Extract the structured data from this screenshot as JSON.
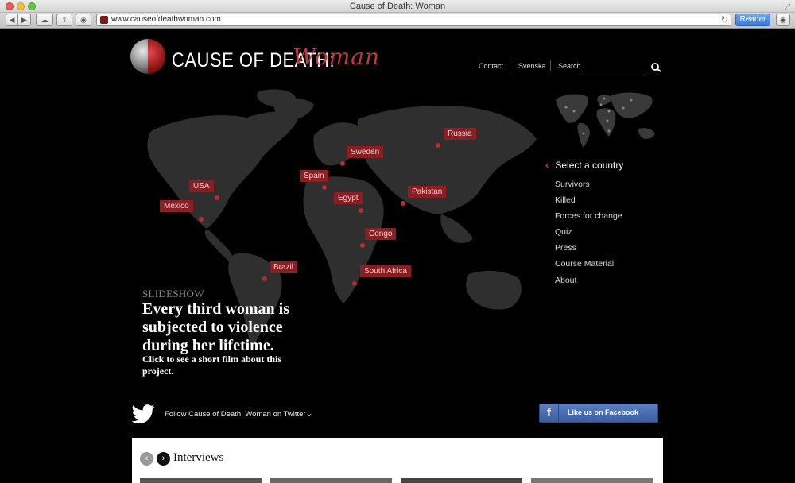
{
  "window": {
    "title": "Cause of Death: Woman"
  },
  "browser": {
    "url": "www.causeofdeathwoman.com",
    "reader_label": "Reader"
  },
  "site": {
    "logo_main": "CAUSE OF DEATH:",
    "logo_script": "Woman"
  },
  "topnav": {
    "contact": "Contact",
    "svenska": "Svenska",
    "search": "Search"
  },
  "map": {
    "pins": [
      {
        "label": "Russia"
      },
      {
        "label": "Sweden"
      },
      {
        "label": "Spain"
      },
      {
        "label": "USA"
      },
      {
        "label": "Egypt"
      },
      {
        "label": "Pakistan"
      },
      {
        "label": "Mexico"
      },
      {
        "label": "Congo"
      },
      {
        "label": "Brazil"
      },
      {
        "label": "South Africa"
      }
    ]
  },
  "sidebar": {
    "select_country": "Select a country",
    "menu": [
      "Survivors",
      "Killed",
      "Forces for change",
      "Quiz",
      "Press",
      "Course Material",
      "About"
    ]
  },
  "slideshow": {
    "label": "SLIDESHOW",
    "headline": "Every third woman is subjected to violence during her lifetime.",
    "subtext": "Click to see a short film about this project."
  },
  "social": {
    "twitter_text": "Follow Cause of Death: Woman on Twitter",
    "facebook_text": "Like us on Facebook"
  },
  "interviews": {
    "title": "Interviews"
  },
  "colors": {
    "accent": "#8a1e23",
    "background": "#000000",
    "facebook": "#3b5da1"
  }
}
